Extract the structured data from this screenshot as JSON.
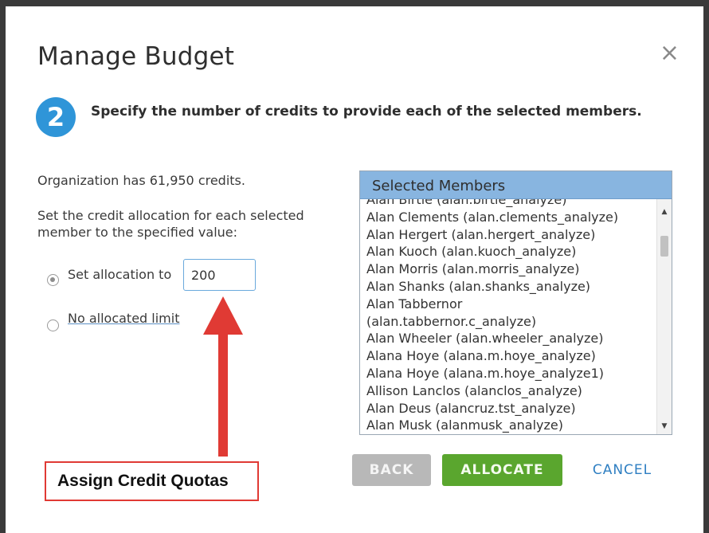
{
  "dialog": {
    "title": "Manage Budget",
    "close_icon": "×",
    "step_number": "2",
    "instruction": "Specify the number of credits to provide each of the selected members."
  },
  "left": {
    "org_credits_text": "Organization has 61,950 credits.",
    "set_text": "Set the credit allocation for each selected member to the specified value:",
    "radio_set_label": "Set allocation to",
    "allocation_value": "200",
    "radio_none_label": "No allocated limit",
    "selected_option": "set_allocation"
  },
  "members": {
    "header": "Selected Members",
    "items": [
      "Alan Birtie (alan.birtie_analyze)",
      "Alan Clements (alan.clements_analyze)",
      "Alan Hergert (alan.hergert_analyze)",
      "Alan Kuoch (alan.kuoch_analyze)",
      "Alan Morris (alan.morris_analyze)",
      "Alan Shanks (alan.shanks_analyze)",
      "Alan Tabbernor",
      "(alan.tabbernor.c_analyze)",
      "Alan Wheeler (alan.wheeler_analyze)",
      "Alana Hoye (alana.m.hoye_analyze)",
      "Alana Hoye (alana.m.hoye_analyze1)",
      "Allison Lanclos (alanclos_analyze)",
      "Alan Deus (alancruz.tst_analyze)",
      "Alan Musk (alanmusk_analyze)"
    ],
    "scroll_up_icon": "▲",
    "scroll_down_icon": "▼"
  },
  "buttons": {
    "back": "BACK",
    "allocate": "ALLOCATE",
    "cancel": "CANCEL"
  },
  "annotation": {
    "callout_text": "Assign Credit Quotas",
    "arrow_color": "#e03a34"
  },
  "colors": {
    "accent_blue": "#2f95d8",
    "header_blue": "#88b5e0",
    "allocate_green": "#5aa62e",
    "back_gray": "#b8b8b8",
    "cancel_blue": "#2f7fc2"
  }
}
